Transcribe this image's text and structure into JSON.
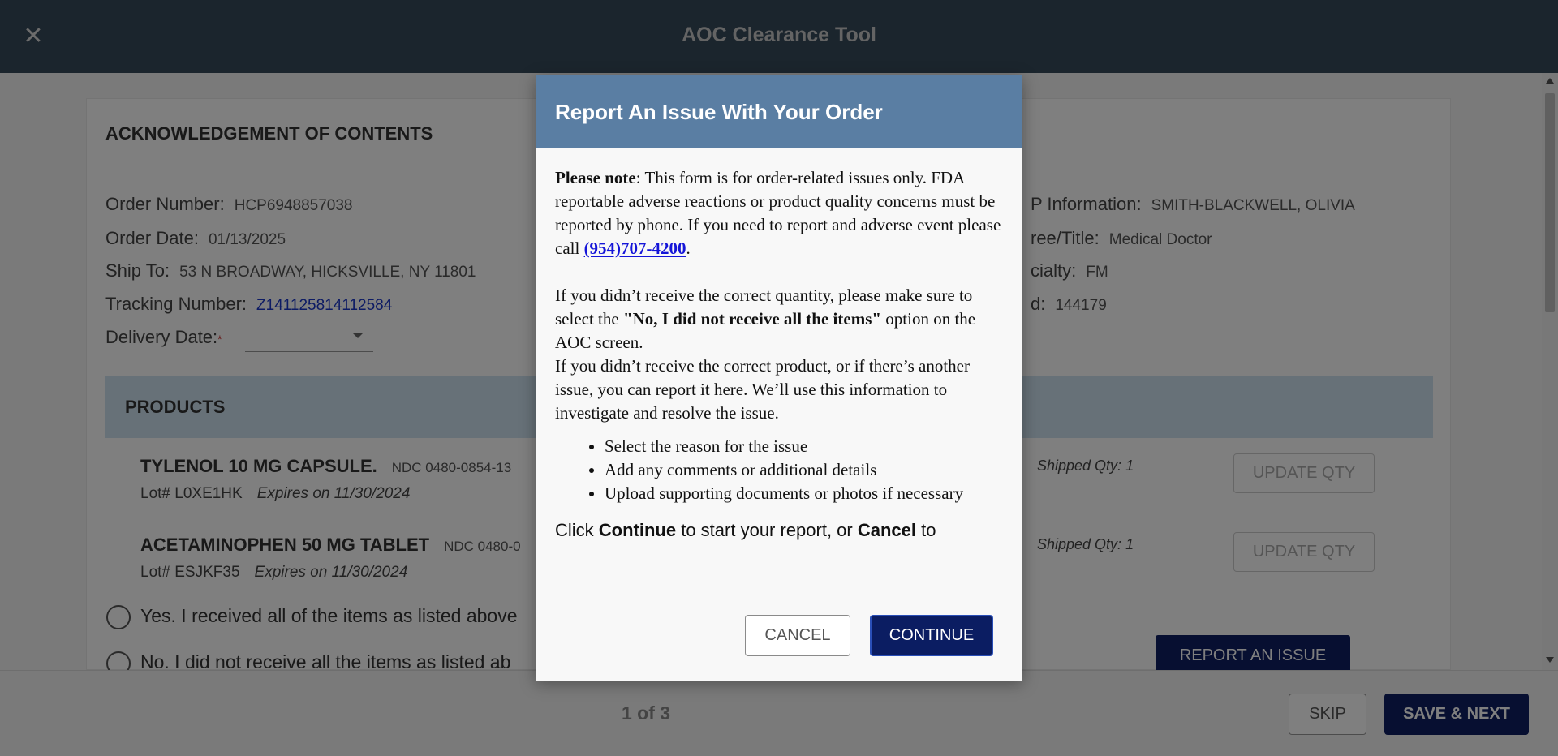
{
  "header": {
    "title": "AOC Clearance Tool",
    "close_glyph": "✕"
  },
  "card": {
    "title": "ACKNOWLEDGEMENT OF CONTENTS",
    "order_number": {
      "label": "Order Number:",
      "value": "HCP6948857038"
    },
    "order_date": {
      "label": "Order Date:",
      "value": "01/13/2025"
    },
    "ship_to": {
      "label": "Ship To:",
      "value": "53 N BROADWAY, HICKSVILLE, NY 11801"
    },
    "tracking": {
      "label": "Tracking Number:",
      "value": "Z141125814112584"
    },
    "delivery": {
      "label": "Delivery Date:",
      "required_mark": "*"
    },
    "hcp_info": {
      "label": "P Information:",
      "value": "SMITH-BLACKWELL, OLIVIA"
    },
    "degree": {
      "label": "ree/Title:",
      "value": "Medical Doctor"
    },
    "specialty": {
      "label": "cialty:",
      "value": "FM"
    },
    "id": {
      "label": "d:",
      "value": "144179"
    }
  },
  "products": {
    "heading": "PRODUCTS",
    "items": [
      {
        "name": "TYLENOL 10 MG CAPSULE.",
        "ndc": "NDC 0480-0854-13",
        "lot": "Lot# L0XE1HK",
        "expires": "Expires on 11/30/2024",
        "shipped": "Shipped Qty: 1",
        "update_label": "UPDATE QTY"
      },
      {
        "name": "ACETAMINOPHEN 50 MG TABLET",
        "ndc": "NDC 0480-0",
        "lot": "Lot# ESJKF35",
        "expires": "Expires on 11/30/2024",
        "shipped": "Shipped Qty: 1",
        "update_label": "UPDATE QTY"
      }
    ]
  },
  "options": {
    "yes_label": "Yes. I received all of the items as listed above",
    "no_label": "No. I did not receive all the items as listed ab"
  },
  "report_issue_label": "REPORT AN ISSUE",
  "footer": {
    "pager": "1 of 3",
    "skip_label": "SKIP",
    "save_label": "SAVE & NEXT"
  },
  "modal": {
    "title": "Report An Issue With Your Order",
    "note_bold": "Please note",
    "note_text": ": This form is for order-related issues only. FDA reportable adverse reactions or product quality concerns must be reported by phone.  If you need to report and adverse event please call ",
    "phone": "(954)707-4200",
    "note_end": ".",
    "para2_a": "If you didn’t receive the correct quantity, please make sure to select the ",
    "para2_bold": "\"No, I did not receive all the items\"",
    "para2_b": " option on the AOC screen.",
    "para3": "If you didn’t receive the correct product, or if there’s another issue, you can report it here. We’ll use this information to investigate and resolve the issue.",
    "bullets": [
      "Select the reason for the issue",
      "Add any comments or additional details",
      "Upload supporting documents or photos if necessary"
    ],
    "click_a": "Click ",
    "click_continue": "Continue",
    "click_b": " to start your report, or ",
    "click_cancel": "Cancel",
    "click_c": " to",
    "cancel_label": "CANCEL",
    "continue_label": "CONTINUE"
  }
}
